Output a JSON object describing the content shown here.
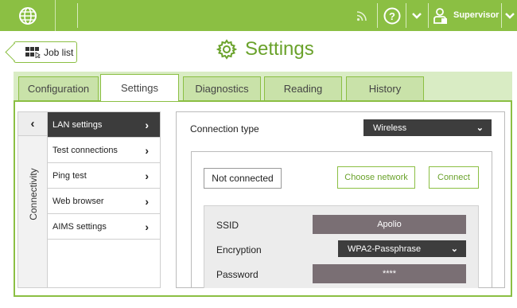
{
  "topbar": {
    "user_label": "Supervisor",
    "brand_color": "#8bbf43",
    "icons": [
      "globe-icon",
      "rss-icon",
      "help-icon",
      "chevron-down-icon",
      "user-icon",
      "chevron-down-icon"
    ]
  },
  "header": {
    "back_button_label": "Job list",
    "title": "Settings"
  },
  "tabs": [
    {
      "label": "Configuration",
      "active": false
    },
    {
      "label": "Settings",
      "active": true
    },
    {
      "label": "Diagnostics",
      "active": false
    },
    {
      "label": "Reading",
      "active": false
    },
    {
      "label": "History",
      "active": false
    }
  ],
  "sidebar": {
    "section_label": "Connectivity",
    "items": [
      {
        "label": "LAN settings",
        "active": true
      },
      {
        "label": "Test connections",
        "active": false
      },
      {
        "label": "Ping test",
        "active": false
      },
      {
        "label": "Web browser",
        "active": false
      },
      {
        "label": "AIMS settings",
        "active": false
      }
    ]
  },
  "lan": {
    "connection_type_label": "Connection type",
    "connection_type_value": "Wireless",
    "status": "Not connected",
    "choose_network_label": "Choose network",
    "connect_label": "Connect",
    "fields": {
      "ssid_label": "SSID",
      "ssid_value": "Apolio",
      "encryption_label": "Encryption",
      "encryption_value": "WPA2-Passphrase",
      "password_label": "Password",
      "password_value": "****"
    }
  }
}
